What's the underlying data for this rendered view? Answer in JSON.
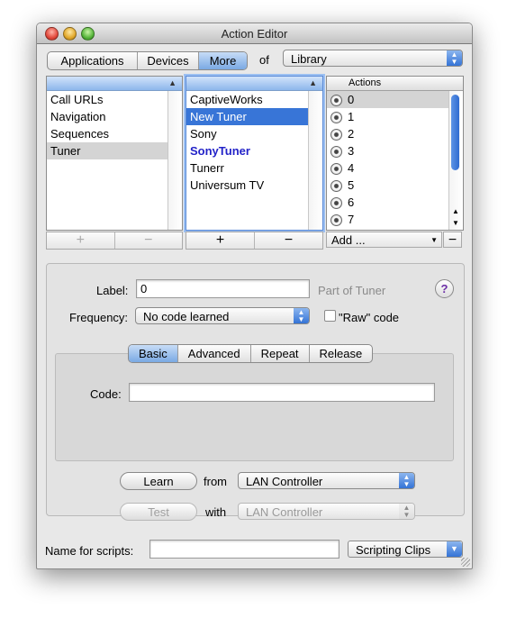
{
  "window": {
    "title": "Action Editor"
  },
  "top_bar": {
    "segments": [
      "Applications",
      "Devices",
      "More"
    ],
    "selected_segment": "More",
    "of_label": "of",
    "library_value": "Library"
  },
  "categories": {
    "items": [
      "Call URLs",
      "Navigation",
      "Sequences",
      "Tuner"
    ],
    "selected": "Tuner"
  },
  "devices": {
    "items": [
      "CaptiveWorks",
      "New Tuner",
      "Sony",
      "SonyTuner",
      "Tunerr",
      "Universum TV"
    ],
    "selected": "New Tuner",
    "bold": "SonyTuner"
  },
  "actions": {
    "header": "Actions",
    "items": [
      "0",
      "1",
      "2",
      "3",
      "4",
      "5",
      "6",
      "7"
    ],
    "selected": "0",
    "add_label": "Add ..."
  },
  "buttons": {
    "plus": "+",
    "minus": "−"
  },
  "editor": {
    "label_label": "Label:",
    "label_value": "0",
    "part_of": "Part of Tuner",
    "help": "?",
    "frequency_label": "Frequency:",
    "frequency_value": "No code learned",
    "raw_code_label": "\"Raw\" code",
    "tabs": [
      "Basic",
      "Advanced",
      "Repeat",
      "Release"
    ],
    "selected_tab": "Basic",
    "code_label": "Code:",
    "code_value": "",
    "learn_label": "Learn",
    "from_label": "from",
    "learn_source": "LAN Controller",
    "test_label": "Test",
    "with_label": "with",
    "test_source": "LAN Controller"
  },
  "footer": {
    "name_label": "Name for scripts:",
    "name_value": "",
    "clips_label": "Scripting Clips"
  }
}
